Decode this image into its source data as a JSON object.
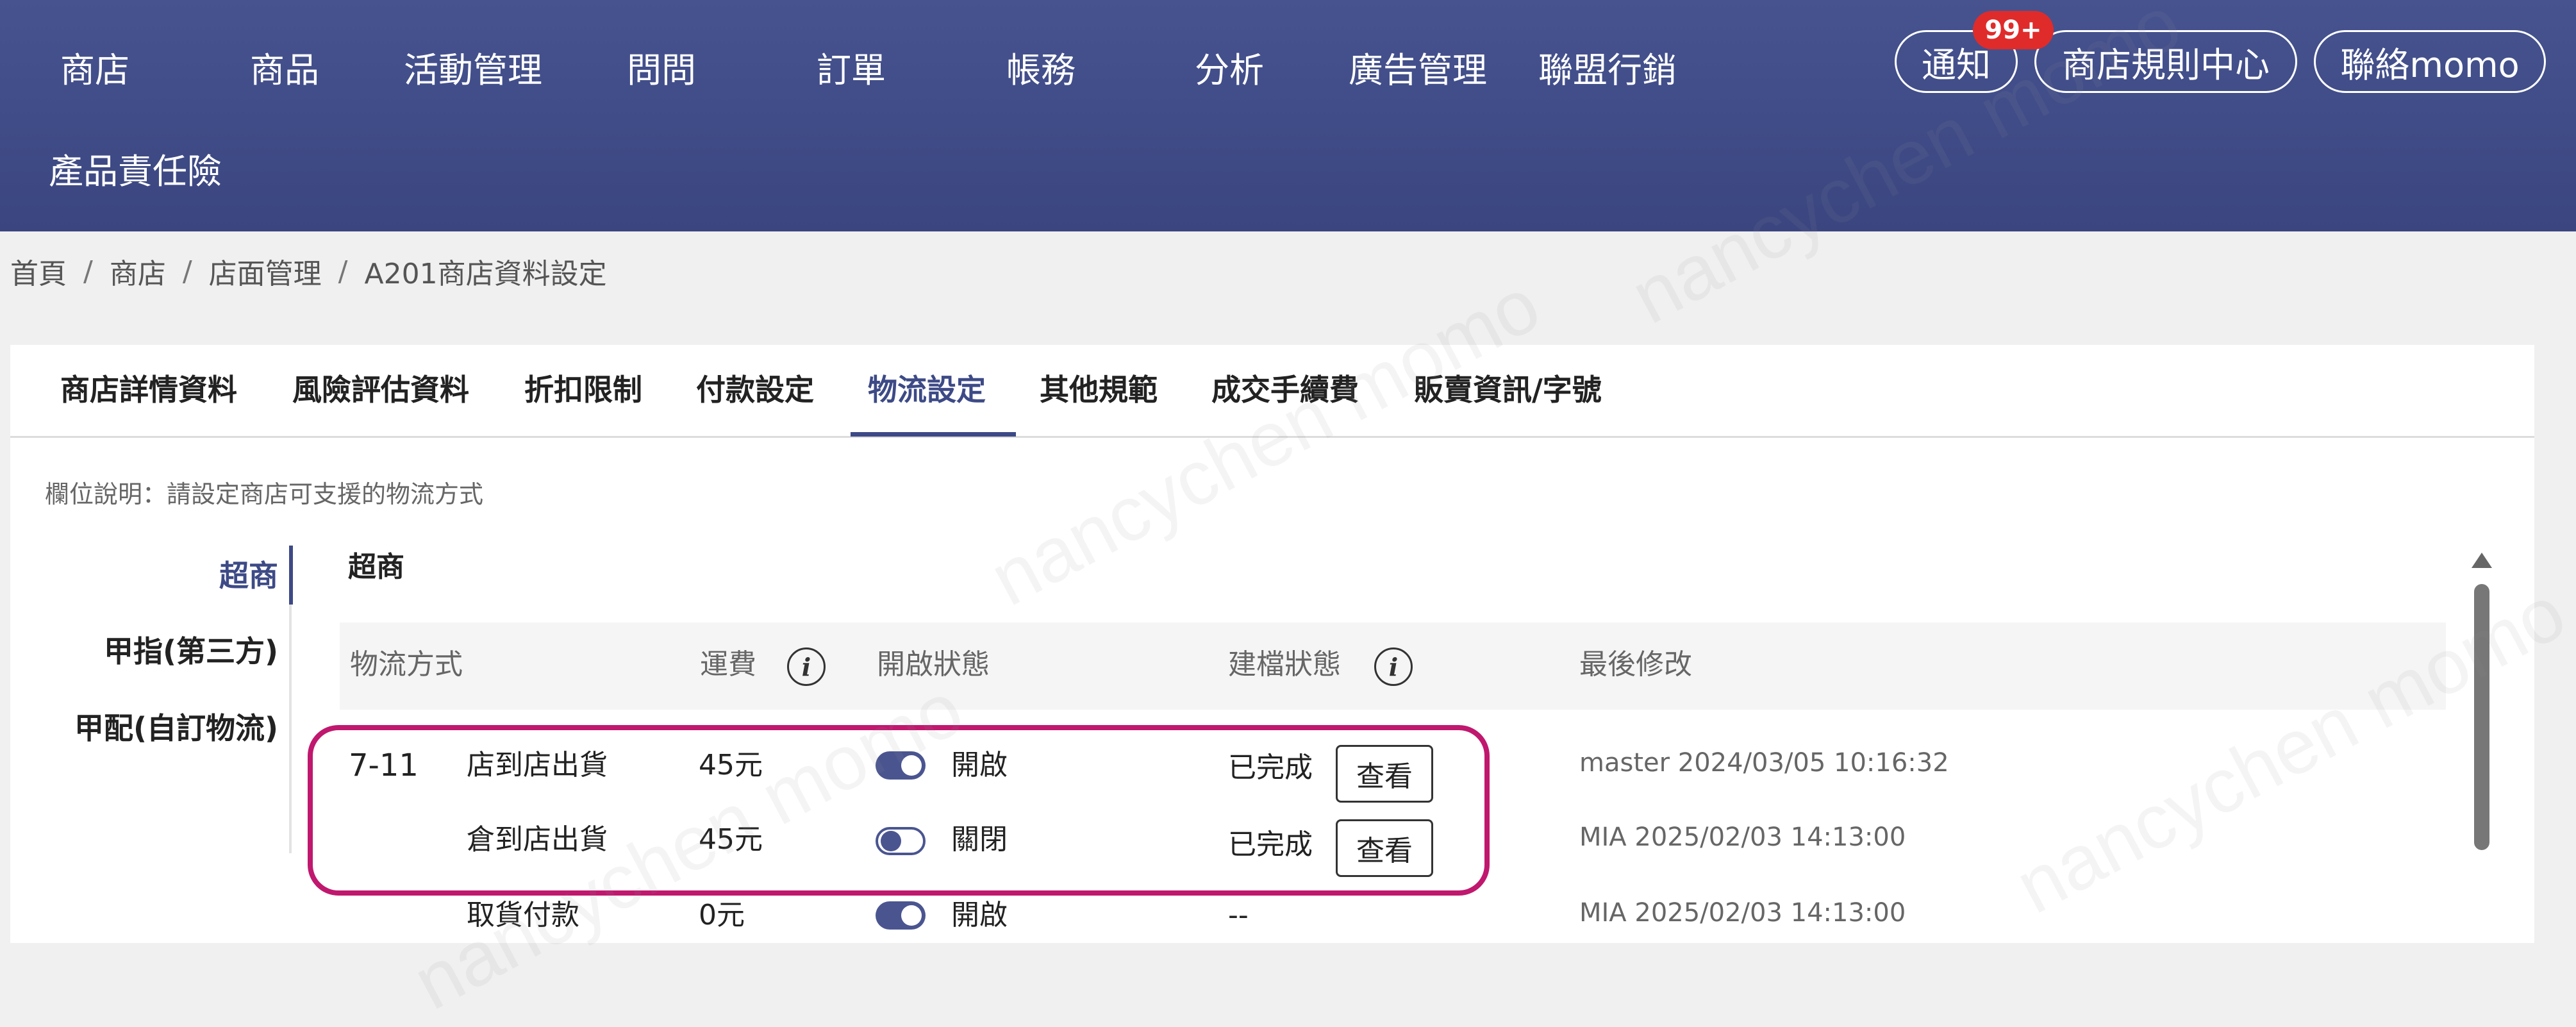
{
  "nav": {
    "items": [
      "商店",
      "商品",
      "活動管理",
      "問問",
      "訂單",
      "帳務",
      "分析",
      "廣告管理",
      "聯盟行銷",
      "產品責任險"
    ],
    "notify_label": "通知",
    "notify_badge": "99+",
    "rules_label": "商店規則中心",
    "contact_label": "聯絡momo"
  },
  "breadcrumb": [
    "首頁",
    "商店",
    "店面管理",
    "A201商店資料設定"
  ],
  "tabs": [
    "商店詳情資料",
    "風險評估資料",
    "折扣限制",
    "付款設定",
    "物流設定",
    "其他規範",
    "成交手續費",
    "販賣資訊/字號"
  ],
  "active_tab": "物流設定",
  "field_description": "欄位說明：請設定商店可支援的物流方式",
  "side_nav": [
    "超商",
    "甲指(第三方)",
    "甲配(自訂物流)"
  ],
  "section_title": "超商",
  "table": {
    "headers": [
      "物流方式",
      "運費",
      "開啟狀態",
      "建檔狀態",
      "最後修改"
    ],
    "rows": [
      {
        "vendor": "7-11",
        "method": "店到店出貨",
        "fee": "45元",
        "toggle_on": true,
        "status": "開啟",
        "file_status": "已完成",
        "view": "查看",
        "modified": "master 2024/03/05 10:16:32"
      },
      {
        "vendor": "",
        "method": "倉到店出貨",
        "fee": "45元",
        "toggle_on": false,
        "status": "關閉",
        "file_status": "已完成",
        "view": "查看",
        "modified": "MIA 2025/02/03 14:13:00"
      },
      {
        "vendor": "",
        "method": "取貨付款",
        "fee": "0元",
        "toggle_on": true,
        "status": "開啟",
        "file_status": "--",
        "view": "",
        "modified": "MIA 2025/02/03 14:13:00"
      }
    ]
  },
  "colors": {
    "header_bg": "#46538f",
    "accent": "#3d4a86",
    "highlight": "#c0186e",
    "badge": "#e02b2b"
  },
  "watermark": "nancychen momo"
}
